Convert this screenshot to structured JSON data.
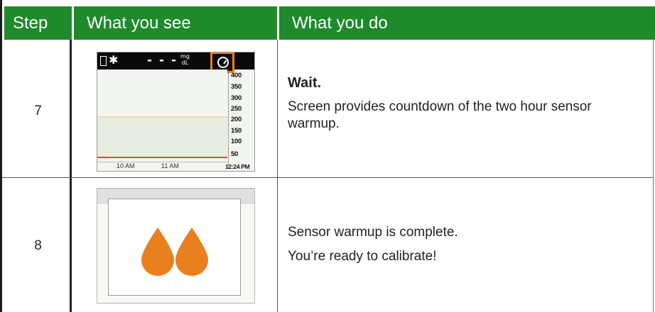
{
  "table": {
    "headers": {
      "step": "Step",
      "see": "What you see",
      "do": "What you do"
    },
    "rows": [
      {
        "step": "7",
        "title": "Wait.",
        "text": "Screen provides countdown of the two hour sensor warmup.",
        "screen": {
          "unit": "mg/dL",
          "glucose_display": "- - -",
          "y_ticks": [
            "400",
            "350",
            "300",
            "250",
            "200",
            "150",
            "100",
            "50"
          ],
          "x_ticks": [
            "10 AM",
            "11 AM"
          ],
          "time": "12:24 PM",
          "highlight_color": "#e8801f",
          "icons": [
            "battery-icon",
            "bluetooth-icon",
            "warmup-clock-icon"
          ]
        }
      },
      {
        "step": "8",
        "lines": [
          "Sensor warmup is complete.",
          "You’re ready to calibrate!"
        ],
        "screen": {
          "drop_color": "#e8801f",
          "icons": [
            "blood-drop-icon",
            "blood-drop-icon"
          ]
        }
      }
    ]
  },
  "colors": {
    "header_bg": "#1f8a2c",
    "header_text": "#ffffff"
  }
}
